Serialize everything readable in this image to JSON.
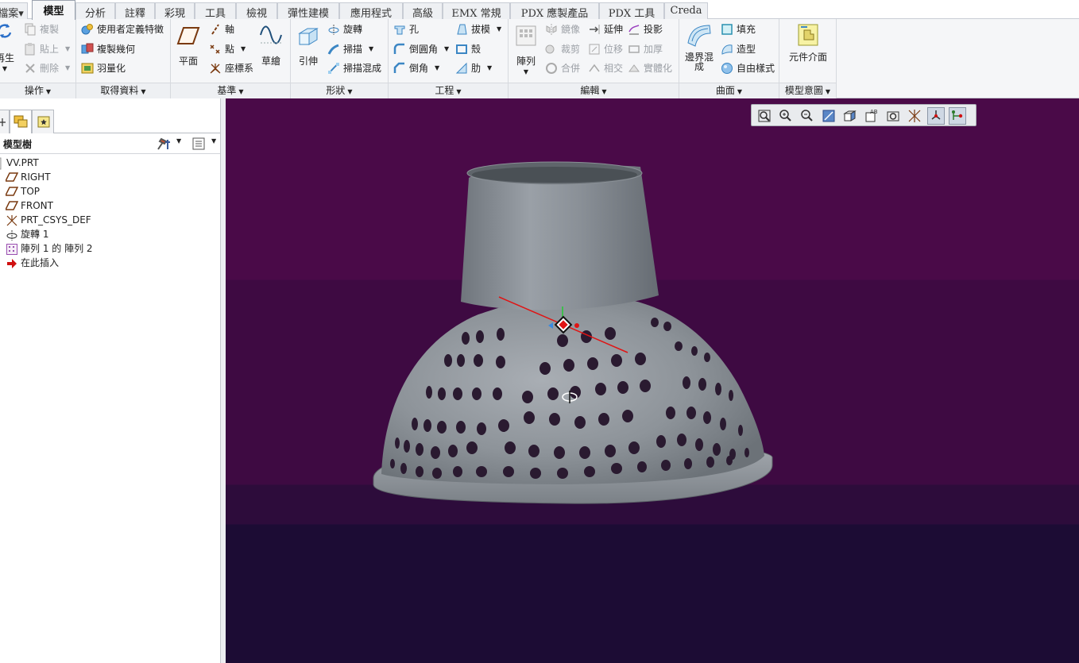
{
  "tabs": [
    {
      "label": "檔案▾",
      "active": false
    },
    {
      "label": "模型",
      "active": true
    },
    {
      "label": "分析",
      "active": false
    },
    {
      "label": "註釋",
      "active": false
    },
    {
      "label": "彩現",
      "active": false
    },
    {
      "label": "工具",
      "active": false
    },
    {
      "label": "檢視",
      "active": false
    },
    {
      "label": "彈性建模",
      "active": false
    },
    {
      "label": "應用程式",
      "active": false
    },
    {
      "label": "高級",
      "active": false
    },
    {
      "label": "EMX 常規",
      "active": false
    },
    {
      "label": "PDX 應製產品",
      "active": false
    },
    {
      "label": "PDX 工具",
      "active": false
    },
    {
      "label": "Creda",
      "active": false
    }
  ],
  "ribbon": {
    "operations": {
      "label": "操作",
      "regenerate": "再生",
      "copy": "複製",
      "paste": "貼上",
      "delete": "刪除"
    },
    "get_data": {
      "label": "取得資料",
      "user_feature": "使用者定義特徵",
      "copy_geometry": "複製幾何",
      "shrinkwrap": "羽量化"
    },
    "datum": {
      "label": "基準",
      "plane": "平面",
      "axis": "軸",
      "point": "點",
      "csys": "座標系",
      "sketch": "草繪"
    },
    "shapes": {
      "label": "形狀",
      "extrude": "引伸",
      "revolve": "旋轉",
      "sweep": "掃描",
      "swept_blend": "掃描混成"
    },
    "engineering": {
      "label": "工程",
      "hole": "孔",
      "round": "倒圓角",
      "chamfer": "倒角",
      "draft": "拔模",
      "shell": "殼",
      "rib": "肋"
    },
    "editing": {
      "label": "編輯",
      "pattern": "陣列",
      "mirror": "鏡像",
      "trim": "裁剪",
      "merge": "合併",
      "extend": "延伸",
      "offset": "位移",
      "intersect": "相交",
      "project": "投影",
      "thicken": "加厚",
      "solidify": "實體化"
    },
    "surfaces": {
      "label": "曲面",
      "boundary_blend": "邊界混成",
      "fill": "填充",
      "style": "造型",
      "freestyle": "自由樣式"
    },
    "model_intent": {
      "label": "模型意圖",
      "component_interface": "元件介面"
    }
  },
  "model_tree": {
    "title": "模型樹",
    "items": [
      {
        "label": "VV.PRT",
        "icon": "part-icon"
      },
      {
        "label": "RIGHT",
        "icon": "datum-plane-icon"
      },
      {
        "label": "TOP",
        "icon": "datum-plane-icon"
      },
      {
        "label": "FRONT",
        "icon": "datum-plane-icon"
      },
      {
        "label": "PRT_CSYS_DEF",
        "icon": "csys-icon"
      },
      {
        "label": "旋轉 1",
        "icon": "revolve-icon"
      },
      {
        "label": "陣列 1 的 陣列 2",
        "icon": "pattern-icon"
      },
      {
        "label": "在此插入",
        "icon": "insert-here-icon"
      }
    ]
  },
  "view_toolbar": [
    "refit-icon",
    "zoom-in-icon",
    "zoom-out-icon",
    "repaint-icon",
    "display-style-icon",
    "saved-orientations-icon",
    "view-manager-icon",
    "datum-display-icon",
    "spin-center-icon",
    "annotation-display-icon"
  ],
  "colors": {
    "viewport_top": "#4a0a48",
    "viewport_bottom": "#1c0c34",
    "model_gray": "#8e949b",
    "active_tab": "#f5f6f8"
  }
}
